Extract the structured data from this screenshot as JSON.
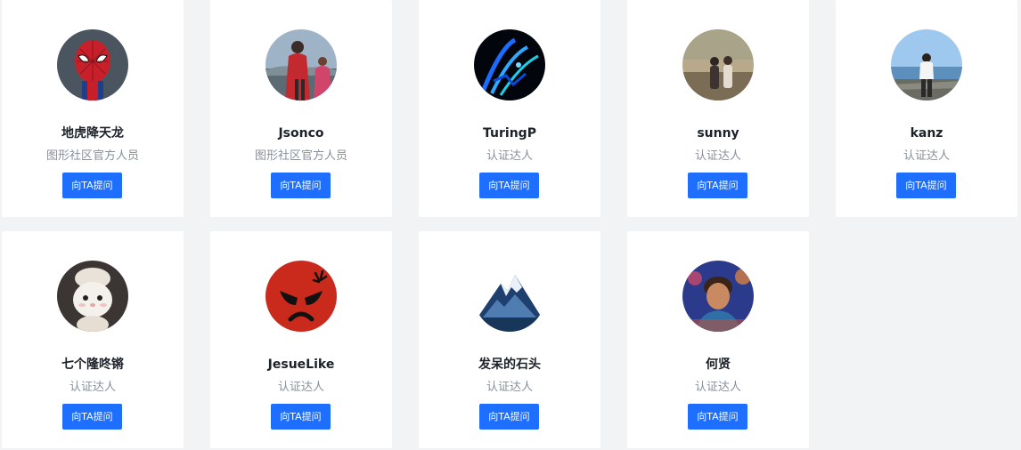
{
  "experts": [
    {
      "name": "地虎降天龙",
      "role": "图形社区官方人员",
      "button": "向TA提问",
      "avatar": "spiderman-avatar-icon"
    },
    {
      "name": "Jsonco",
      "role": "图形社区官方人员",
      "button": "向TA提问",
      "avatar": "person-red-coat-avatar-icon"
    },
    {
      "name": "TuringP",
      "role": "认证达人",
      "button": "向TA提问",
      "avatar": "neon-abstract-avatar-icon"
    },
    {
      "name": "sunny",
      "role": "认证达人",
      "button": "向TA提问",
      "avatar": "couple-landscape-avatar-icon"
    },
    {
      "name": "kanz",
      "role": "认证达人",
      "button": "向TA提问",
      "avatar": "person-seaside-avatar-icon"
    },
    {
      "name": "七个隆咚锵",
      "role": "认证达人",
      "button": "向TA提问",
      "avatar": "bunny-avatar-icon"
    },
    {
      "name": "JesueLike",
      "role": "认证达人",
      "button": "向TA提问",
      "avatar": "angry-face-avatar-icon"
    },
    {
      "name": "发呆的石头",
      "role": "认证达人",
      "button": "向TA提问",
      "avatar": "mountain-avatar-icon"
    },
    {
      "name": "何贤",
      "role": "认证达人",
      "button": "向TA提问",
      "avatar": "boy-portrait-avatar-icon"
    }
  ],
  "colors": {
    "page_background": "#f2f3f5",
    "card_background": "#ffffff",
    "button": "#1e6fff",
    "name_text": "#1d2129",
    "role_text": "#86909c"
  }
}
